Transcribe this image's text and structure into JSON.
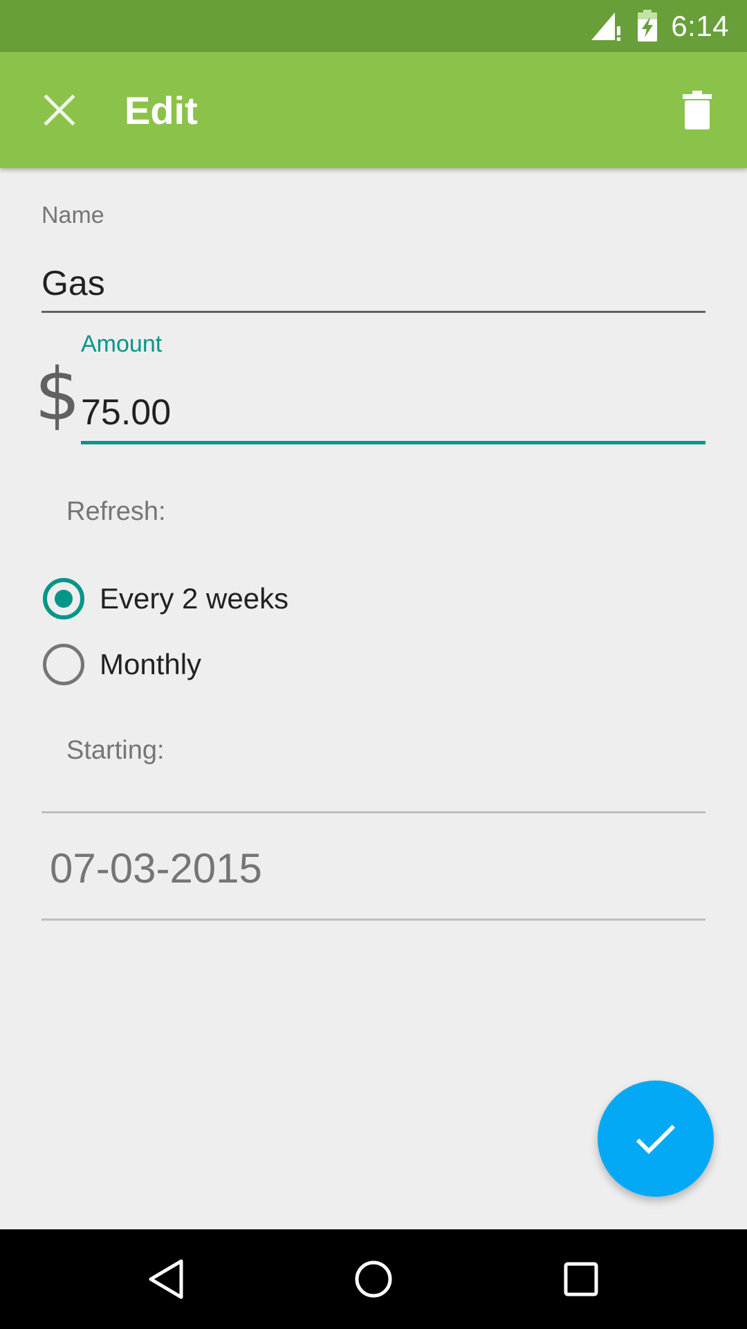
{
  "status_bar": {
    "time": "6:14",
    "icons": [
      "signal-alert-icon",
      "battery-charging-icon"
    ]
  },
  "app_bar": {
    "title": "Edit",
    "close_icon": "close-icon",
    "delete_icon": "delete-icon",
    "background_color": "#8bc34a"
  },
  "form": {
    "name": {
      "label": "Name",
      "value": "Gas"
    },
    "amount": {
      "label": "Amount",
      "currency_symbol": "$",
      "value": "75.00"
    },
    "refresh": {
      "label": "Refresh:",
      "options": [
        {
          "label": "Every 2 weeks",
          "selected": true
        },
        {
          "label": "Monthly",
          "selected": false
        }
      ]
    },
    "starting": {
      "label": "Starting:",
      "date": "07-03-2015"
    }
  },
  "fab": {
    "icon": "check-icon",
    "color": "#03a9f4"
  },
  "nav_bar": {
    "buttons": [
      "back-icon",
      "home-icon",
      "recents-icon"
    ]
  },
  "colors": {
    "accent": "#009688",
    "status_bar": "#689f38"
  }
}
